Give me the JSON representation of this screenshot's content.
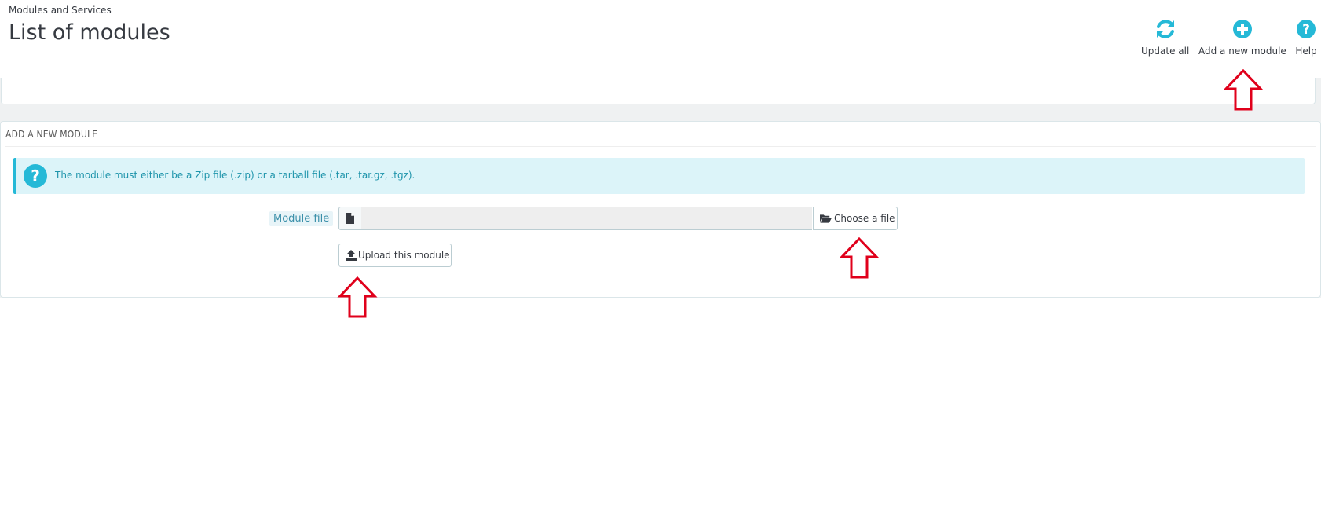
{
  "header": {
    "breadcrumb": "Modules and Services",
    "title": "List of modules"
  },
  "toolbar": {
    "update_all": "Update all",
    "add_module": "Add a new module",
    "help": "Help"
  },
  "panel": {
    "heading": "Add a new module",
    "info_text": "The module must either be a Zip file (.zip) or a tarball file (.tar, .tar.gz, .tgz).",
    "module_file_label": "Module file",
    "file_value": "",
    "choose_label": "Choose a file",
    "upload_label": "Upload this module"
  },
  "colors": {
    "accent": "#25b9d7",
    "annotation_arrow": "#e0001b",
    "info_bg": "#dcf4f9"
  },
  "icons": {
    "update_all": "refresh-icon",
    "add_module": "plus-circle-icon",
    "help": "question-circle-icon",
    "info": "question-circle-icon",
    "file": "file-icon",
    "choose": "folder-open-icon",
    "upload": "upload-icon"
  }
}
